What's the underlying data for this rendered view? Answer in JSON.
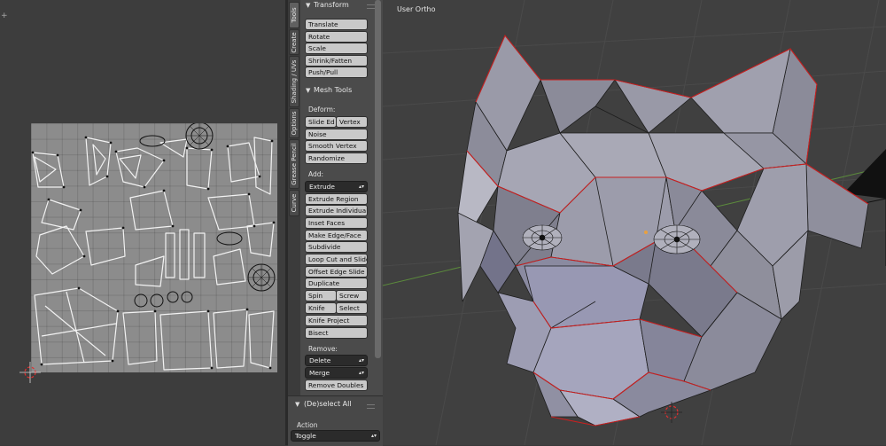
{
  "shelf": {
    "tabs": [
      "Tools",
      "Create",
      "Shading / UVs",
      "Options",
      "Grease Pencil",
      "Curve"
    ],
    "transform": {
      "title": "Transform",
      "buttons": [
        "Translate",
        "Rotate",
        "Scale",
        "Shrink/Fatten",
        "Push/Pull"
      ]
    },
    "mesh_tools": {
      "title": "Mesh Tools",
      "deform_label": "Deform:",
      "slide_edge": "Slide Ed",
      "vertex": "Vertex",
      "noise": "Noise",
      "smooth_vertex": "Smooth Vertex",
      "randomize": "Randomize",
      "add_label": "Add:",
      "extrude": "Extrude",
      "extrude_region": "Extrude Region",
      "extrude_individual": "Extrude Individual",
      "inset_faces": "Inset Faces",
      "make_edge_face": "Make Edge/Face",
      "subdivide": "Subdivide",
      "loop_cut": "Loop Cut and Slide",
      "offset_edge_slide": "Offset Edge Slide",
      "duplicate": "Duplicate",
      "spin": "Spin",
      "screw": "Screw",
      "knife": "Knife",
      "select": "Select",
      "knife_project": "Knife Project",
      "bisect": "Bisect",
      "remove_label": "Remove:",
      "delete": "Delete",
      "merge": "Merge",
      "remove_doubles": "Remove Doubles"
    }
  },
  "operator": {
    "title": "(De)select All",
    "action_label": "Action",
    "action_value": "Toggle"
  },
  "viewport": {
    "label": "User Ortho",
    "mesh_color": "#9a9aa8",
    "seam_color": "#d02020",
    "background": "#404040"
  },
  "uv_editor": {
    "background": "#8c8c8c"
  }
}
